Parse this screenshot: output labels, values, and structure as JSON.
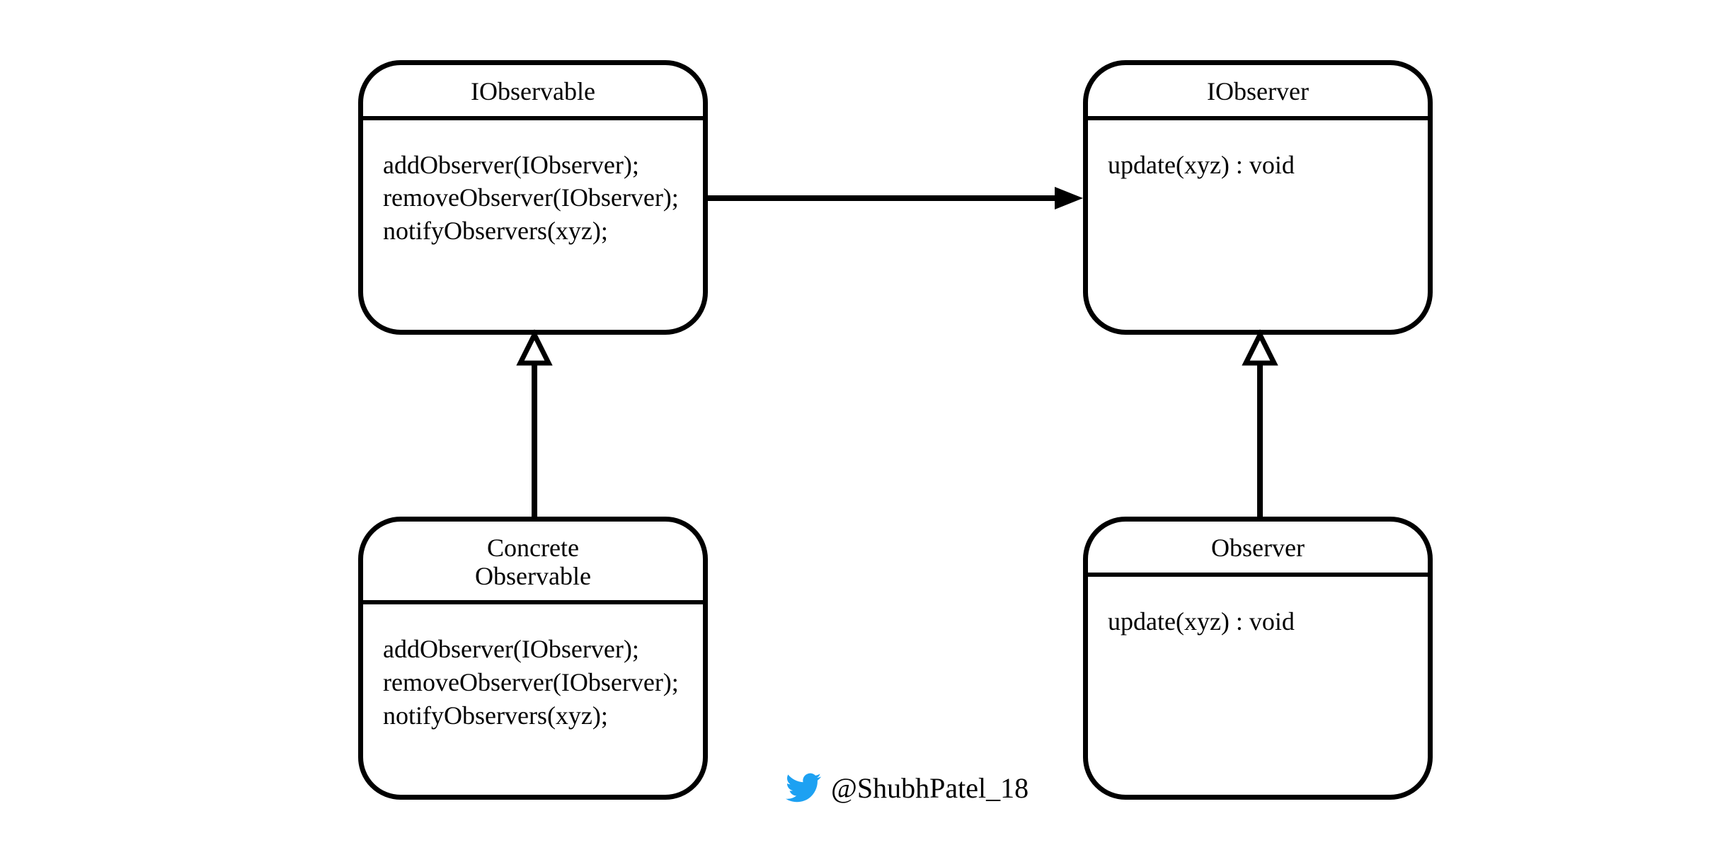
{
  "boxes": {
    "iobservable": {
      "title": "IObservable",
      "body": "addObserver(IObserver);\nremoveObserver(IObserver);\nnotifyObservers(xyz);"
    },
    "concrete_observable": {
      "title": "Concrete\nObservable",
      "body": "addObserver(IObserver);\nremoveObserver(IObserver);\nnotifyObservers(xyz);"
    },
    "iobserver": {
      "title": "IObserver",
      "body": "update(xyz) : void"
    },
    "observer": {
      "title": "Observer",
      "body": "update(xyz) : void"
    }
  },
  "attribution": {
    "handle": "@ShubhPatel_18"
  },
  "colors": {
    "stroke": "#000000",
    "twitter": "#1DA1F2"
  }
}
